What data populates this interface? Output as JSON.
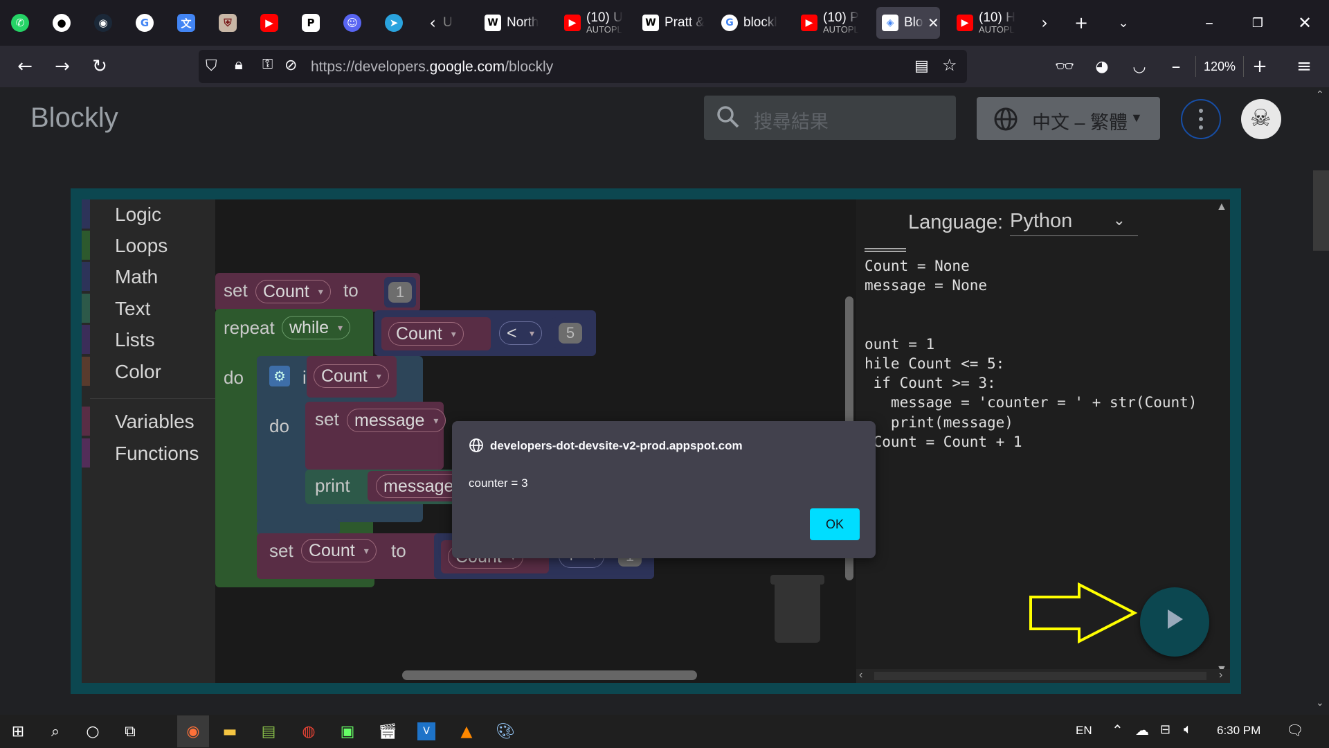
{
  "tabs": [
    {
      "title": "U",
      "sub": ""
    },
    {
      "title": "North",
      "sub": ""
    },
    {
      "title": "(10) U",
      "sub": "AUTOPL"
    },
    {
      "title": "Pratt &",
      "sub": ""
    },
    {
      "title": "blockl",
      "sub": ""
    },
    {
      "title": "(10) P",
      "sub": "AUTOPL"
    },
    {
      "title": "Bloc",
      "sub": ""
    },
    {
      "title": "(10) H",
      "sub": "AUTOPL"
    }
  ],
  "nav": {
    "url_prefix": "https://developers.",
    "url_domain": "google.com",
    "url_path": "/blockly",
    "zoom": "120%"
  },
  "site": {
    "logo": "Blockly",
    "search_placeholder": "搜尋結果",
    "language_button": "中文 – 繁體"
  },
  "toolbox": {
    "categories": [
      {
        "label": "Logic",
        "color": "#5b67a5"
      },
      {
        "label": "Loops",
        "color": "#5ba55b"
      },
      {
        "label": "Math",
        "color": "#5b67a5"
      },
      {
        "label": "Text",
        "color": "#5ba58c"
      },
      {
        "label": "Lists",
        "color": "#745ba5"
      },
      {
        "label": "Color",
        "color": "#a5745b"
      },
      {
        "label": "Variables",
        "color": "#a55b80"
      },
      {
        "label": "Functions",
        "color": "#995ba5"
      }
    ]
  },
  "blocks": {
    "set1": {
      "kw": "set",
      "var": "Count",
      "to": "to",
      "val": "1"
    },
    "repeat": {
      "kw": "repeat",
      "mode": "while",
      "var": "Count",
      "op": "<",
      "val": "5"
    },
    "do": "do",
    "if": {
      "kw": "if",
      "var": "Count"
    },
    "do2": "do",
    "set_msg": {
      "kw": "set",
      "var": "message"
    },
    "print": {
      "kw": "print",
      "var": "message"
    },
    "set2": {
      "kw": "set",
      "var": "Count",
      "to": "to",
      "var2": "Count",
      "op": "+",
      "val": "1"
    }
  },
  "code_pane": {
    "language_label": "Language:",
    "language_value": "Python",
    "code": "Count = None\nmessage = None\n\n\nount = 1\nhile Count <= 5:\n if Count >= 3:\n   message = 'counter = ' + str(Count)\n   print(message)\n Count = Count + 1"
  },
  "dialog": {
    "origin": "developers-dot-devsite-v2-prod.appspot.com",
    "message": "counter = 3",
    "ok": "OK"
  },
  "taskbar": {
    "lang": "EN",
    "time": "6:30 PM"
  },
  "colors": {
    "frame": "#0c4750",
    "run_button": "#0c4750",
    "arrow": "#ffff00",
    "ok_button": "#00ddff",
    "variable_block": "#a55b80",
    "loop_block": "#5ba55b",
    "logic_block": "#5b80a5",
    "text_block": "#5ba58c"
  }
}
